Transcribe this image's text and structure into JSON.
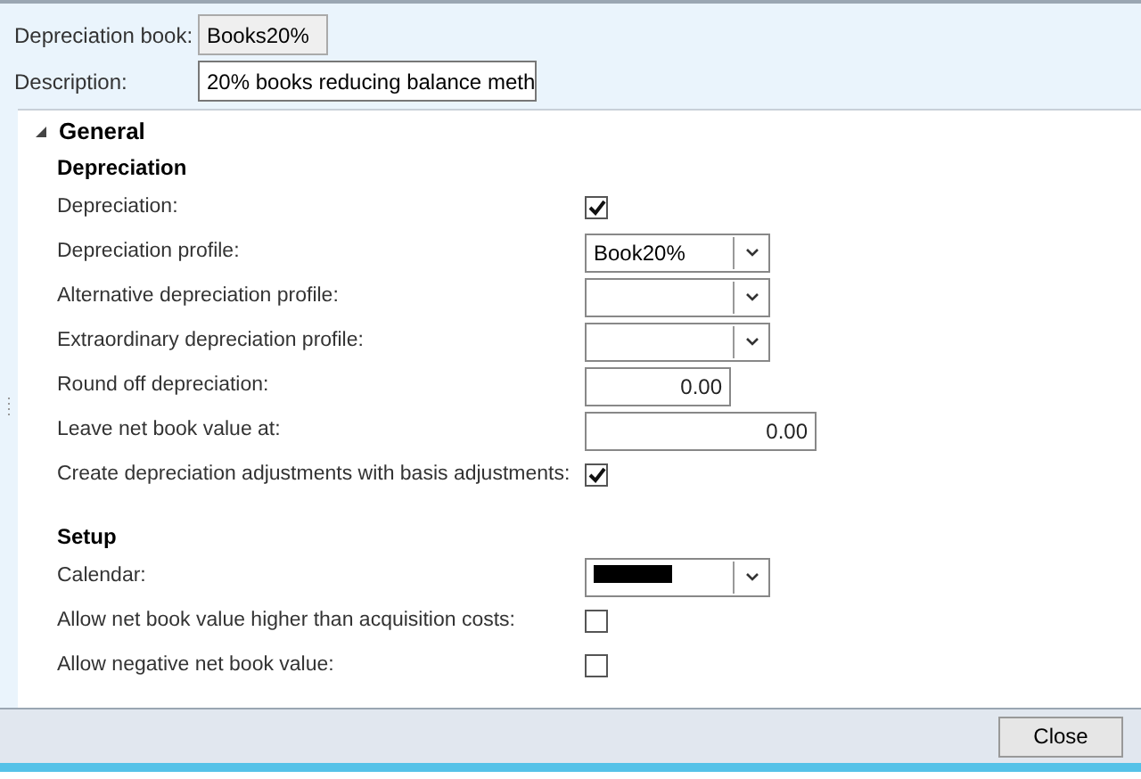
{
  "header": {
    "fields": [
      {
        "label": "Depreciation book:",
        "value": "Books20%",
        "disabled": true
      },
      {
        "label": "Description:",
        "value": "20% books reducing balance meth",
        "disabled": false
      }
    ]
  },
  "group": {
    "title": "General",
    "expanded": true,
    "sections": [
      {
        "title": "Depreciation",
        "rows": [
          {
            "kind": "checkbox",
            "label": "Depreciation:",
            "checked": true
          },
          {
            "kind": "combo",
            "label": "Depreciation profile:",
            "value": "Book20%"
          },
          {
            "kind": "combo",
            "label": "Alternative depreciation profile:"
          },
          {
            "kind": "combo",
            "label": "Extraordinary depreciation profile:"
          },
          {
            "kind": "number",
            "label": "Round off depreciation:",
            "value": "0.00"
          },
          {
            "kind": "wide-number",
            "label": "Leave net book value at:",
            "value": "0.00"
          },
          {
            "kind": "checkbox",
            "label": "Create depreciation adjustments with basis adjustments:",
            "checked": true
          }
        ]
      },
      {
        "title": "Setup",
        "rows": [
          {
            "kind": "combo",
            "label": "Calendar:",
            "redacted": true
          },
          {
            "kind": "checkbox",
            "label": "Allow net book value higher than acquisition costs:",
            "checked": false
          },
          {
            "kind": "checkbox",
            "label": "Allow negative net book value:",
            "checked": false
          }
        ]
      }
    ]
  },
  "buttons": [
    "Close"
  ]
}
